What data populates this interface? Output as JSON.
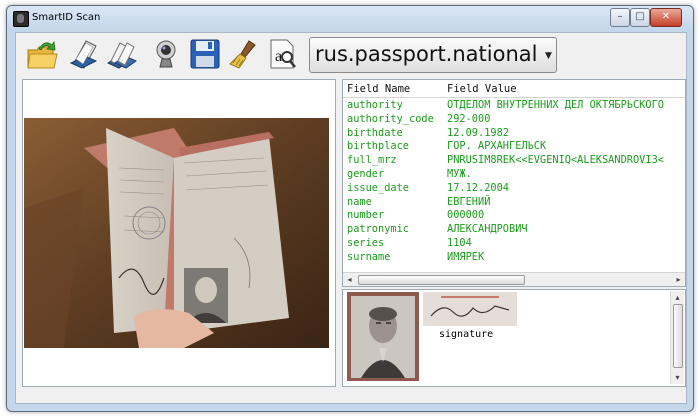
{
  "window": {
    "title": "SmartID Scan",
    "minimize": "–",
    "maximize": "□",
    "close": "✕"
  },
  "toolbar": {
    "icons": [
      "open-folder-icon",
      "scan-icon",
      "scan-double-icon",
      "webcam-icon",
      "save-icon",
      "clear-brush-icon",
      "recognize-text-icon"
    ],
    "document_type": "rus.passport.national",
    "recognize_glyph": "a"
  },
  "fields": {
    "header": {
      "name": "Field Name",
      "value": "Field Value"
    },
    "rows": [
      {
        "name": "authority",
        "value": "ОТДЕЛОМ ВНУТРЕННИХ ДЕЛ ОКТЯБРЬСКОГО"
      },
      {
        "name": "authority_code",
        "value": "292-000"
      },
      {
        "name": "birthdate",
        "value": "12.09.1982"
      },
      {
        "name": "birthplace",
        "value": "ГОР. АРХАНГЕЛЬСК"
      },
      {
        "name": "full_mrz",
        "value": "PNRUSIM8REK<<EVGENIQ<ALEKSANDROVI3<"
      },
      {
        "name": "gender",
        "value": "МУЖ."
      },
      {
        "name": "issue_date",
        "value": "17.12.2004"
      },
      {
        "name": "name",
        "value": "ЕВГЕНИЙ"
      },
      {
        "name": "number",
        "value": "000000"
      },
      {
        "name": "patronymic",
        "value": "АЛЕКСАНДРОВИЧ"
      },
      {
        "name": "series",
        "value": "1104"
      },
      {
        "name": "surname",
        "value": "ИМЯРЕК"
      }
    ],
    "scroll_left": "◂",
    "scroll_right": "▸"
  },
  "images": {
    "signature_label": "signature",
    "scroll_up": "▴",
    "scroll_down": "▾"
  },
  "colors": {
    "field_text": "#1f9b1f",
    "window_frame": "#c3d6ea",
    "close_button": "#c4402a"
  }
}
